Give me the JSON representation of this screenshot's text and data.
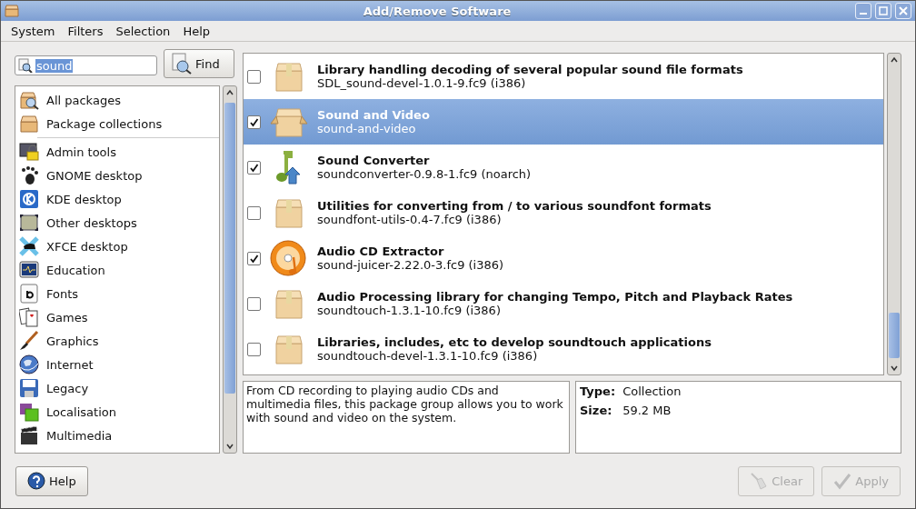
{
  "window": {
    "title": "Add/Remove Software"
  },
  "menu": [
    "System",
    "Filters",
    "Selection",
    "Help"
  ],
  "search": {
    "value": "sound",
    "button": "Find"
  },
  "groups": [
    {
      "label": "All packages",
      "selected": false
    },
    {
      "label": "Package collections",
      "selected": false
    }
  ],
  "categories": [
    {
      "label": "Admin tools",
      "selected": false
    },
    {
      "label": "GNOME desktop",
      "selected": false
    },
    {
      "label": "KDE desktop",
      "selected": false
    },
    {
      "label": "Other desktops",
      "selected": false
    },
    {
      "label": "XFCE desktop",
      "selected": false
    },
    {
      "label": "Education",
      "selected": false
    },
    {
      "label": "Fonts",
      "selected": false
    },
    {
      "label": "Games",
      "selected": false
    },
    {
      "label": "Graphics",
      "selected": false
    },
    {
      "label": "Internet",
      "selected": false
    },
    {
      "label": "Legacy",
      "selected": false
    },
    {
      "label": "Localisation",
      "selected": false
    },
    {
      "label": "Multimedia",
      "selected": false
    }
  ],
  "packages": [
    {
      "title": "Library handling decoding of several popular sound file formats",
      "name": "SDL_sound-devel-1.0.1-9.fc9 (i386)",
      "checked": false,
      "selected": false
    },
    {
      "title": "Sound and Video",
      "name": "sound-and-video",
      "checked": true,
      "selected": true
    },
    {
      "title": "Sound Converter",
      "name": "soundconverter-0.9.8-1.fc9 (noarch)",
      "checked": true,
      "selected": false
    },
    {
      "title": "Utilities for converting from / to various soundfont formats",
      "name": "soundfont-utils-0.4-7.fc9 (i386)",
      "checked": false,
      "selected": false
    },
    {
      "title": "Audio CD Extractor",
      "name": "sound-juicer-2.22.0-3.fc9 (i386)",
      "checked": true,
      "selected": false
    },
    {
      "title": "Audio Processing library for changing Tempo, Pitch and Playback Rates",
      "name": "soundtouch-1.3.1-10.fc9 (i386)",
      "checked": false,
      "selected": false
    },
    {
      "title": "Libraries, includes, etc to develop soundtouch applications",
      "name": "soundtouch-devel-1.3.1-10.fc9 (i386)",
      "checked": false,
      "selected": false
    }
  ],
  "description": "From CD recording to playing audio CDs and multimedia files, this package group allows you to work with sound and video on the system.",
  "details": [
    {
      "label": "Type:",
      "value": "Collection"
    },
    {
      "label": "Size:",
      "value": "59.2 MB"
    }
  ],
  "buttons": {
    "help": {
      "label": "Help",
      "disabled": false
    },
    "clear": {
      "label": "Clear",
      "disabled": true
    },
    "apply": {
      "label": "Apply",
      "disabled": true
    }
  }
}
